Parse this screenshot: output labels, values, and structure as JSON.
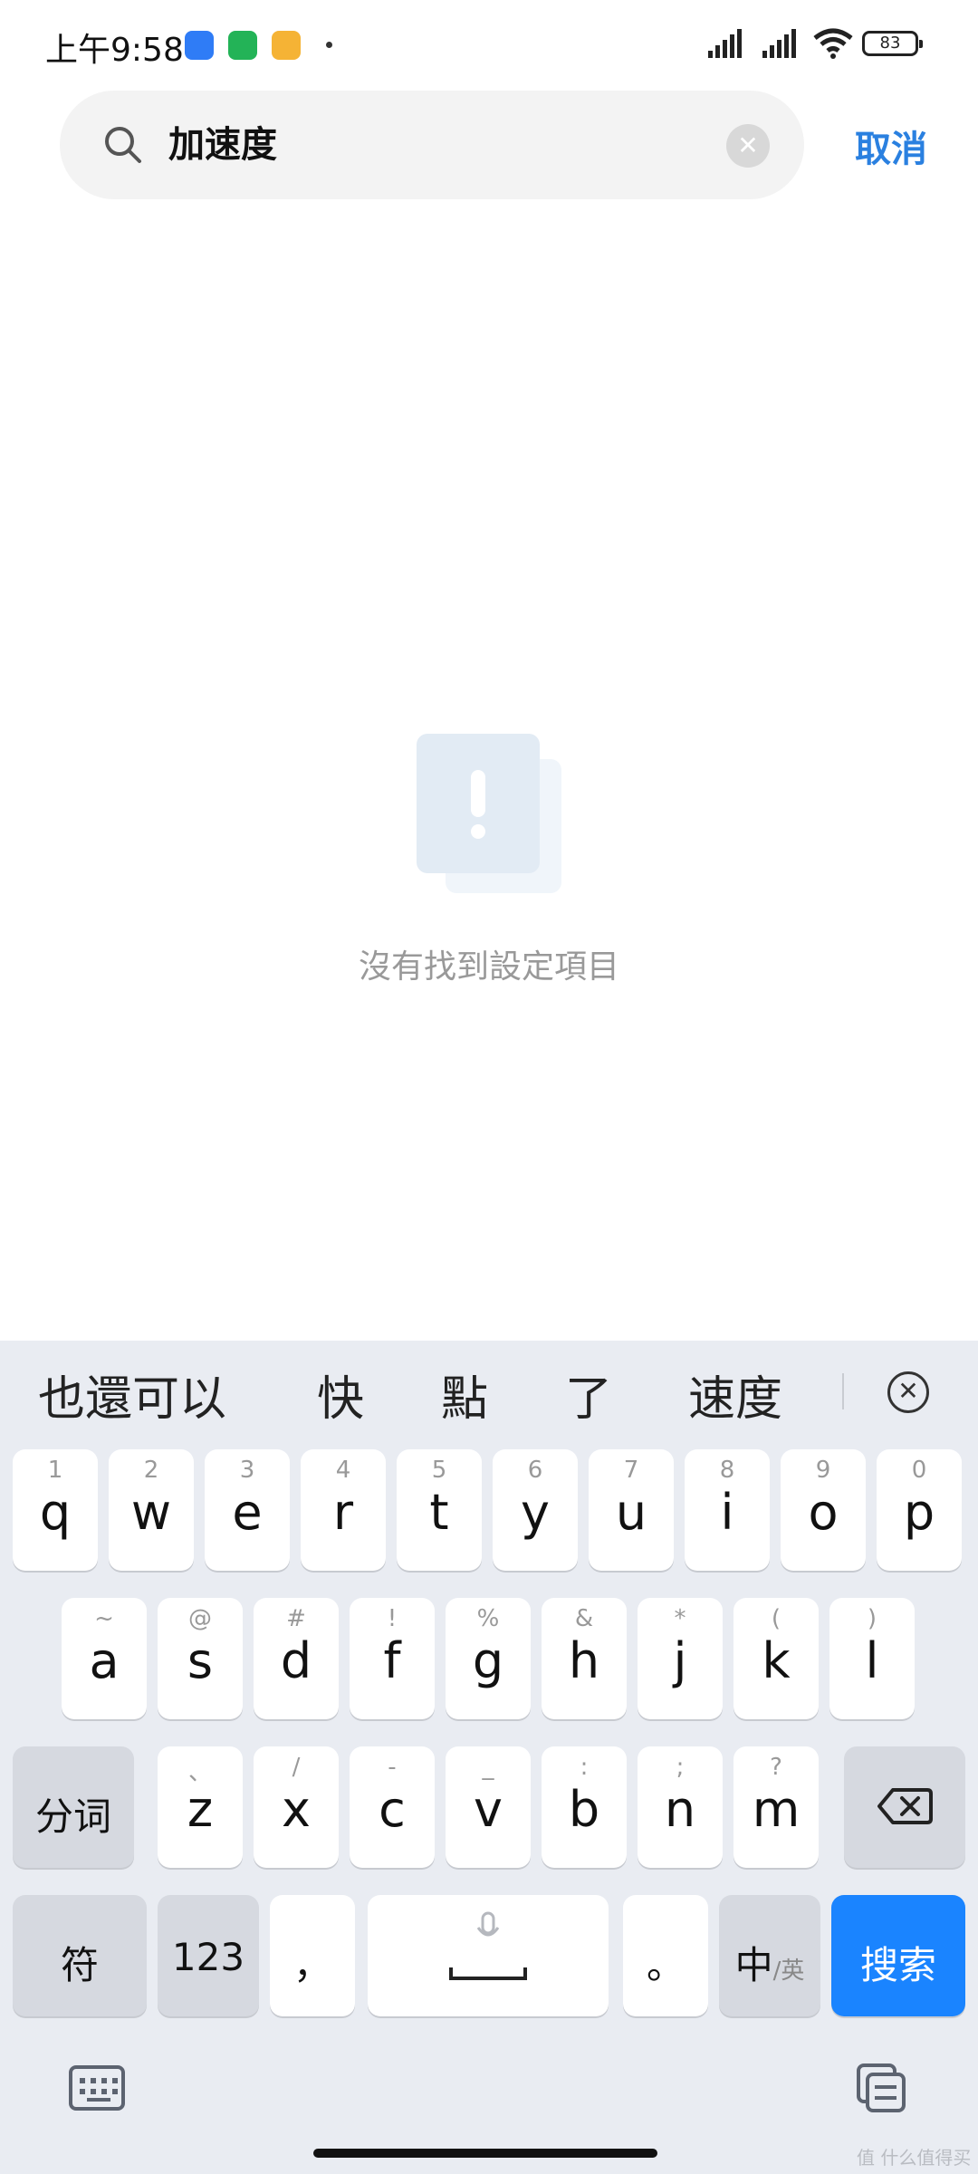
{
  "status_bar": {
    "time": "上午9:58",
    "battery": "83"
  },
  "search": {
    "query": "加速度",
    "cancel_label": "取消"
  },
  "empty_state": {
    "message": "沒有找到設定項目"
  },
  "keyboard": {
    "candidates": [
      "也還可以",
      "快",
      "點",
      "了",
      "速度"
    ],
    "row1": [
      {
        "hint": "1",
        "key": "q"
      },
      {
        "hint": "2",
        "key": "w"
      },
      {
        "hint": "3",
        "key": "e"
      },
      {
        "hint": "4",
        "key": "r"
      },
      {
        "hint": "5",
        "key": "t"
      },
      {
        "hint": "6",
        "key": "y"
      },
      {
        "hint": "7",
        "key": "u"
      },
      {
        "hint": "8",
        "key": "i"
      },
      {
        "hint": "9",
        "key": "o"
      },
      {
        "hint": "0",
        "key": "p"
      }
    ],
    "row2": [
      {
        "hint": "~",
        "key": "a"
      },
      {
        "hint": "@",
        "key": "s"
      },
      {
        "hint": "#",
        "key": "d"
      },
      {
        "hint": "!",
        "key": "f"
      },
      {
        "hint": "%",
        "key": "g"
      },
      {
        "hint": "&",
        "key": "h"
      },
      {
        "hint": "*",
        "key": "j"
      },
      {
        "hint": "(",
        "key": "k"
      },
      {
        "hint": ")",
        "key": "l"
      }
    ],
    "row3": [
      {
        "hint": "、",
        "key": "z"
      },
      {
        "hint": "/",
        "key": "x"
      },
      {
        "hint": "-",
        "key": "c"
      },
      {
        "hint": "_",
        "key": "v"
      },
      {
        "hint": ":",
        "key": "b"
      },
      {
        "hint": ";",
        "key": "n"
      },
      {
        "hint": "?",
        "key": "m"
      }
    ],
    "segment_label": "分词",
    "symbol_label": "符",
    "numeric_label": "123",
    "comma_label": "，",
    "period_label": "。",
    "lang_label": "中",
    "lang_sub_label": "/英",
    "search_label": "搜索"
  },
  "watermark": "值 什么值得买",
  "colors": {
    "accent": "#2a80e0",
    "search_key": "#1a84ff"
  }
}
